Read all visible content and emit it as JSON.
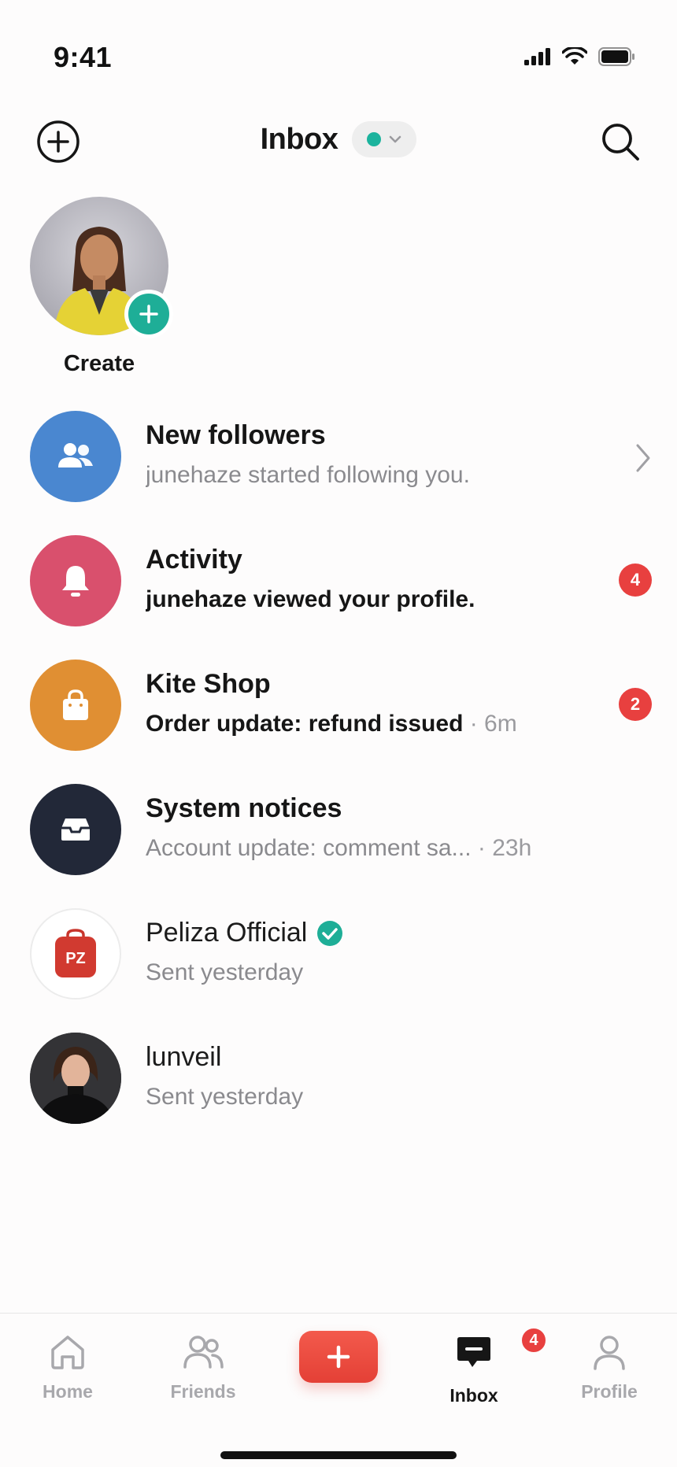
{
  "status_bar": {
    "time": "9:41"
  },
  "header": {
    "title": "Inbox",
    "status_color": "#1bb39d"
  },
  "story": {
    "label": "Create"
  },
  "rows": [
    {
      "title": "New followers",
      "subtitle": "junehaze started following you.",
      "meta": "",
      "icon": "followers-icon",
      "color": "#4a87d0"
    },
    {
      "title": "Activity",
      "subtitle": "junehaze viewed your profile.",
      "meta": "",
      "badge": "4",
      "icon": "bell-icon",
      "color": "#d9506d"
    },
    {
      "title": "Kite Shop",
      "subtitle": "Order update: refund issued",
      "meta": " · 6m",
      "badge": "2",
      "icon": "shopping-bag-icon",
      "color": "#e08f33"
    },
    {
      "title": "System notices",
      "subtitle": "Account update: comment sa... ",
      "meta": "· 23h",
      "icon": "inbox-tray-icon",
      "color": "#222838"
    },
    {
      "title": "Peliza Official",
      "subtitle": "Sent yesterday",
      "logo_text": "PZ",
      "verified": true,
      "icon": "peliza-logo"
    },
    {
      "title": "lunveil",
      "subtitle": "Sent yesterday",
      "icon": "user-photo"
    }
  ],
  "nav": {
    "home": "Home",
    "friends": "Friends",
    "inbox": "Inbox",
    "inbox_badge": "4",
    "profile": "Profile",
    "active": "inbox"
  }
}
